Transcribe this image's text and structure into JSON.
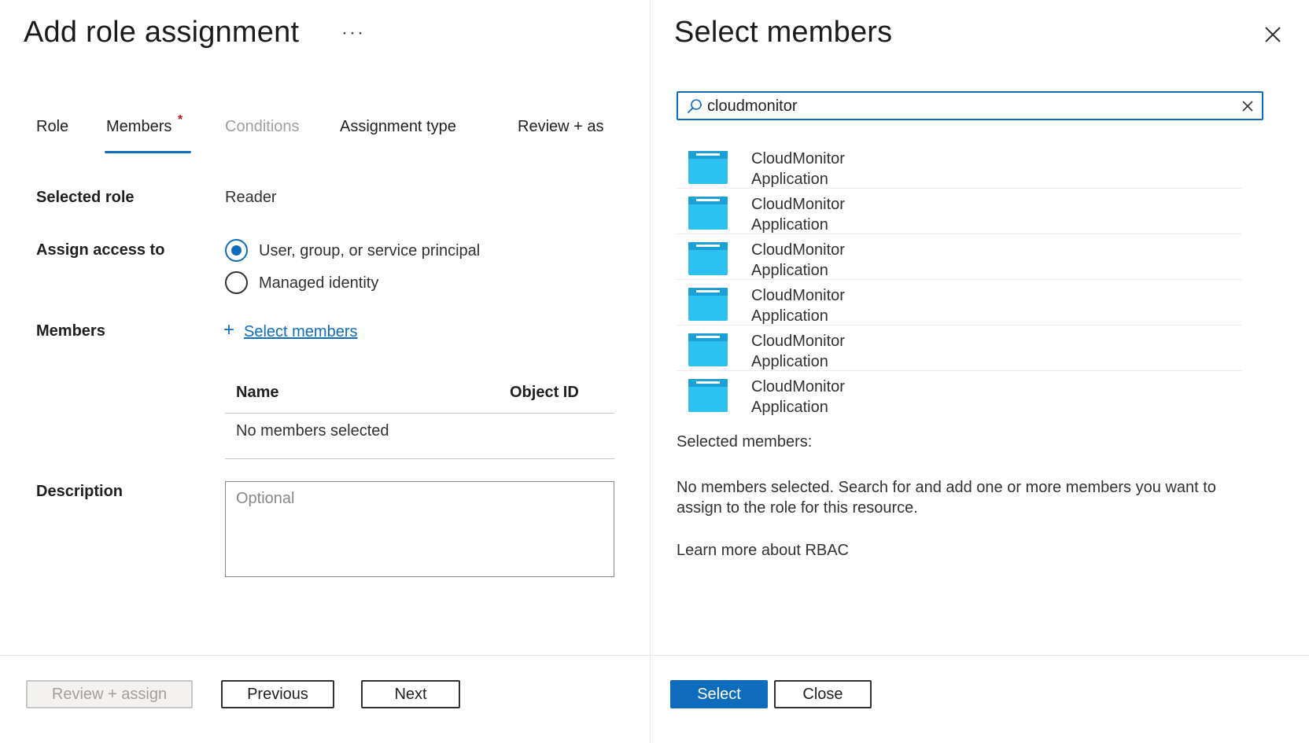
{
  "left_panel": {
    "title": "Add role assignment",
    "more_label": "···",
    "tabs": [
      {
        "label": "Role"
      },
      {
        "label": "Members",
        "required_mark": "*"
      },
      {
        "label": "Conditions"
      },
      {
        "label": "Assignment type"
      },
      {
        "label": "Review + as"
      }
    ],
    "selected_role": {
      "label": "Selected role",
      "value": "Reader"
    },
    "assign_access": {
      "label": "Assign access to",
      "options": [
        {
          "label": "User, group, or service principal",
          "checked": true
        },
        {
          "label": "Managed identity",
          "checked": false
        }
      ]
    },
    "members": {
      "label": "Members",
      "add_icon": "+",
      "select_link": "Select members",
      "columns": [
        "Name",
        "Object ID"
      ],
      "empty_text": "No members selected"
    },
    "description": {
      "label": "Description",
      "placeholder": "Optional"
    },
    "footer": {
      "review_assign": "Review + assign",
      "previous": "Previous",
      "next": "Next"
    }
  },
  "right_panel": {
    "title": "Select members",
    "search": {
      "value": "cloudmonitor"
    },
    "results": [
      {
        "name": "CloudMonitor",
        "type": "Application"
      },
      {
        "name": "CloudMonitor",
        "type": "Application"
      },
      {
        "name": "CloudMonitor",
        "type": "Application"
      },
      {
        "name": "CloudMonitor",
        "type": "Application"
      },
      {
        "name": "CloudMonitor",
        "type": "Application"
      },
      {
        "name": "CloudMonitor",
        "type": "Application"
      }
    ],
    "selected_label": "Selected members:",
    "no_selection_line1": "No members selected. Search for and add one or more members you want to",
    "no_selection_line2": "assign to the role for this resource.",
    "learn_more": "Learn more about RBAC",
    "footer": {
      "select": "Select",
      "close": "Close"
    }
  },
  "colors": {
    "accent": "#0f6cbd",
    "required": "#c50f1f",
    "app_icon": "#28b4e8"
  }
}
